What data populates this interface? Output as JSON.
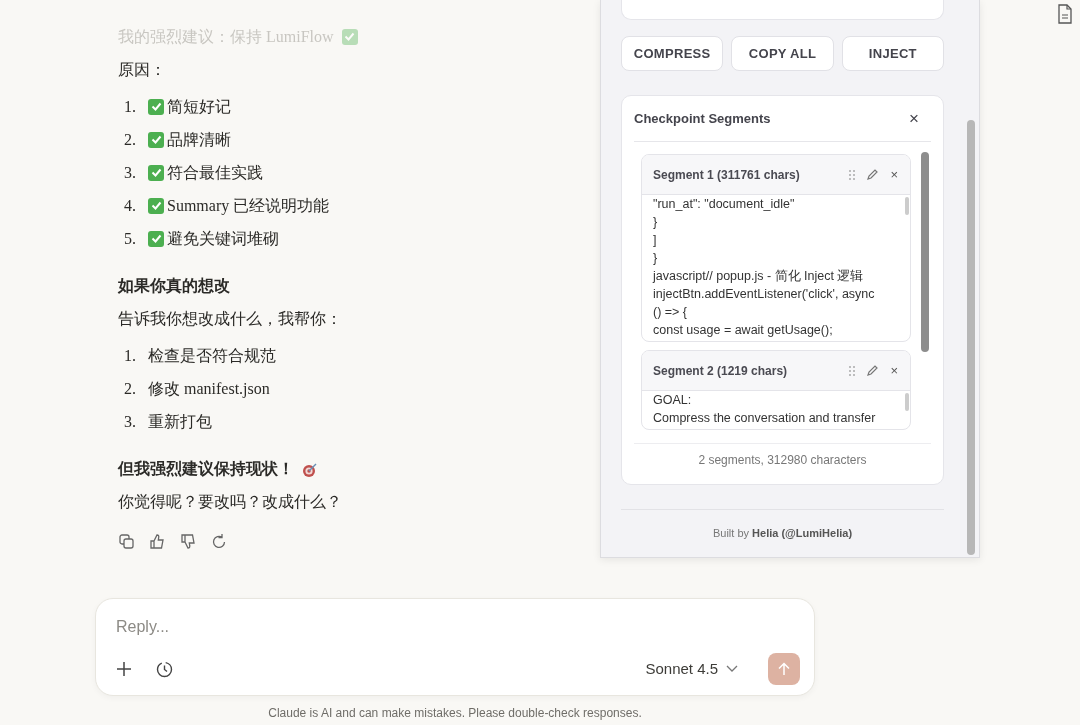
{
  "chat": {
    "blocks": [
      {
        "kind": "faded",
        "text": "我的强烈建议：保持 LumiFlow",
        "check": true
      },
      {
        "kind": "para",
        "text": "原因："
      },
      {
        "kind": "list",
        "items": [
          {
            "number": "1.",
            "check": true,
            "text": "简短好记"
          },
          {
            "number": "2.",
            "check": true,
            "text": "品牌清晰"
          },
          {
            "number": "3.",
            "check": true,
            "text": "符合最佳实践"
          },
          {
            "number": "4.",
            "check": true,
            "text": "Summary 已经说明功能"
          },
          {
            "number": "5.",
            "check": true,
            "text": "避免关键词堆砌"
          }
        ]
      },
      {
        "kind": "heading",
        "text": "如果你真的想改"
      },
      {
        "kind": "para",
        "text": "告诉我你想改成什么，我帮你："
      },
      {
        "kind": "list",
        "items": [
          {
            "number": "1.",
            "check": false,
            "text": "检查是否符合规范"
          },
          {
            "number": "2.",
            "check": false,
            "text": "修改 manifest.json"
          },
          {
            "number": "3.",
            "check": false,
            "text": "重新打包"
          }
        ]
      },
      {
        "kind": "emphasis",
        "text": "但我强烈建议保持现状！"
      },
      {
        "kind": "para",
        "text": "你觉得呢？要改吗？改成什么？"
      }
    ]
  },
  "panel": {
    "buttons": [
      "COMPRESS",
      "COPY ALL",
      "INJECT"
    ],
    "segments_card": {
      "title": "Checkpoint Segments",
      "close": "×",
      "segments": [
        {
          "title": "Segment 1 (311761 chars)",
          "delete": "×",
          "lines": [
            "\"run_at\": \"document_idle\"",
            "}",
            "]",
            "}",
            "javascript// popup.js - 简化 Inject 逻辑",
            "injectBtn.addEventListener('click', async",
            "() => {",
            "const usage = await getUsage();"
          ]
        },
        {
          "title": "Segment 2 (1219 chars)",
          "delete": "×",
          "lines": [
            "GOAL:",
            "Compress the conversation and transfer"
          ]
        }
      ],
      "summary": "2 segments, 312980 characters"
    },
    "footer": "Built by **Helia (@LumiHelia)**"
  },
  "composer": {
    "placeholder": "Reply...",
    "model": "Sonnet 4.5"
  },
  "disclaimer": "Claude is AI and can make mistakes. Please double-check responses."
}
